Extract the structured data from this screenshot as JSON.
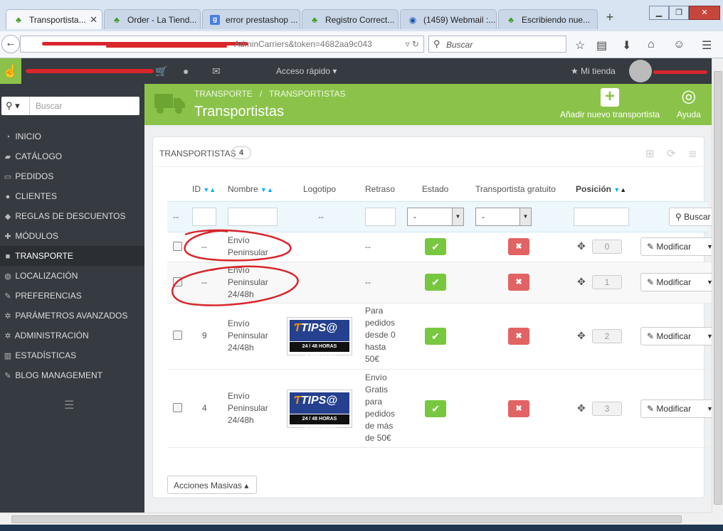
{
  "browser": {
    "tabs": [
      {
        "label": "Transportista...",
        "favicon": "prestashop-icon",
        "active": true
      },
      {
        "label": "Order - La Tiend...",
        "favicon": "prestashop-icon",
        "active": false
      },
      {
        "label": "error prestashop ...",
        "favicon": "google-icon",
        "active": false
      },
      {
        "label": "Registro Correct...",
        "favicon": "prestashop-icon",
        "active": false
      },
      {
        "label": "(1459) Webmail :...",
        "favicon": "webmail-icon",
        "active": false
      },
      {
        "label": "Escribiendo nue...",
        "favicon": "prestashop-icon",
        "active": false
      }
    ],
    "url_visible": "AdminCarriers&token=4682aa9c043",
    "search_placeholder": "Buscar"
  },
  "adminbar": {
    "quick_access": "Acceso rápido ▾",
    "my_store": "Mi tienda"
  },
  "sidebar": {
    "search_placeholder": "Buscar",
    "items": [
      {
        "label": "INICIO",
        "icon": "dashboard-icon",
        "active": false
      },
      {
        "label": "CATÁLOGO",
        "icon": "book-icon",
        "active": false
      },
      {
        "label": "PEDIDOS",
        "icon": "credit-card-icon",
        "active": false
      },
      {
        "label": "CLIENTES",
        "icon": "users-icon",
        "active": false
      },
      {
        "label": "REGLAS DE DESCUENTOS",
        "icon": "tags-icon",
        "active": false
      },
      {
        "label": "MÓDULOS",
        "icon": "puzzle-icon",
        "active": false
      },
      {
        "label": "TRANSPORTE",
        "icon": "truck-icon",
        "active": true
      },
      {
        "label": "LOCALIZACIÓN",
        "icon": "globe-icon",
        "active": false
      },
      {
        "label": "PREFERENCIAS",
        "icon": "wrench-icon",
        "active": false
      },
      {
        "label": "PARÁMETROS AVANZADOS",
        "icon": "cogs-icon",
        "active": false
      },
      {
        "label": "ADMINISTRACIÓN",
        "icon": "cog-icon",
        "active": false
      },
      {
        "label": "ESTADÍSTICAS",
        "icon": "bar-chart-icon",
        "active": false
      },
      {
        "label": "BLOG MANAGEMENT",
        "icon": "pencil-icon",
        "active": false
      }
    ]
  },
  "header": {
    "breadcrumb": [
      "TRANSPORTE",
      "/",
      "TRANSPORTISTAS"
    ],
    "title": "Transportistas",
    "add_button": "Añadir nuevo transportista",
    "help_button": "Ayuda"
  },
  "panel": {
    "title": "TRANSPORTISTAS",
    "count": "4",
    "columns": {
      "id": "ID",
      "name": "Nombre",
      "logo": "Logotipo",
      "delay": "Retraso",
      "status": "Estado",
      "free": "Transportista gratuito",
      "position": "Posición"
    },
    "filter": {
      "logo_placeholder": "--",
      "status_value": "-",
      "free_value": "-",
      "search_button": "Buscar",
      "select_all": "--"
    },
    "rows": [
      {
        "id": "--",
        "name": "Envío Peninsular",
        "logo": "",
        "delay": "--",
        "active": true,
        "free": false,
        "position": "0",
        "edit": "Modificar"
      },
      {
        "id": "--",
        "name": "Envío Peninsular 24/48h",
        "logo": "",
        "delay": "--",
        "active": true,
        "free": false,
        "position": "1",
        "edit": "Modificar"
      },
      {
        "id": "9",
        "name": "Envío Peninsular 24/48h",
        "logo": "tips",
        "delay": "Para pedidos desde 0 hasta 50€",
        "active": true,
        "free": false,
        "position": "2",
        "edit": "Modificar"
      },
      {
        "id": "4",
        "name": "Envío Peninsular 24/48h",
        "logo": "tips",
        "delay": "Envío Gratis para pedidos de más de 50€",
        "active": true,
        "free": false,
        "position": "3",
        "edit": "Modificar"
      }
    ],
    "logo_text": {
      "brand": "TIPS@",
      "tagline": "24 / 48 HORAS PENINSULAR"
    },
    "bulk_actions": "Acciones Masivas ▴"
  },
  "colors": {
    "header_green": "#8bc34a",
    "sidebar_dark": "#363a41",
    "enabled_green": "#78c740",
    "disabled_red": "#e26363",
    "annotation_red": "#d9262b"
  }
}
